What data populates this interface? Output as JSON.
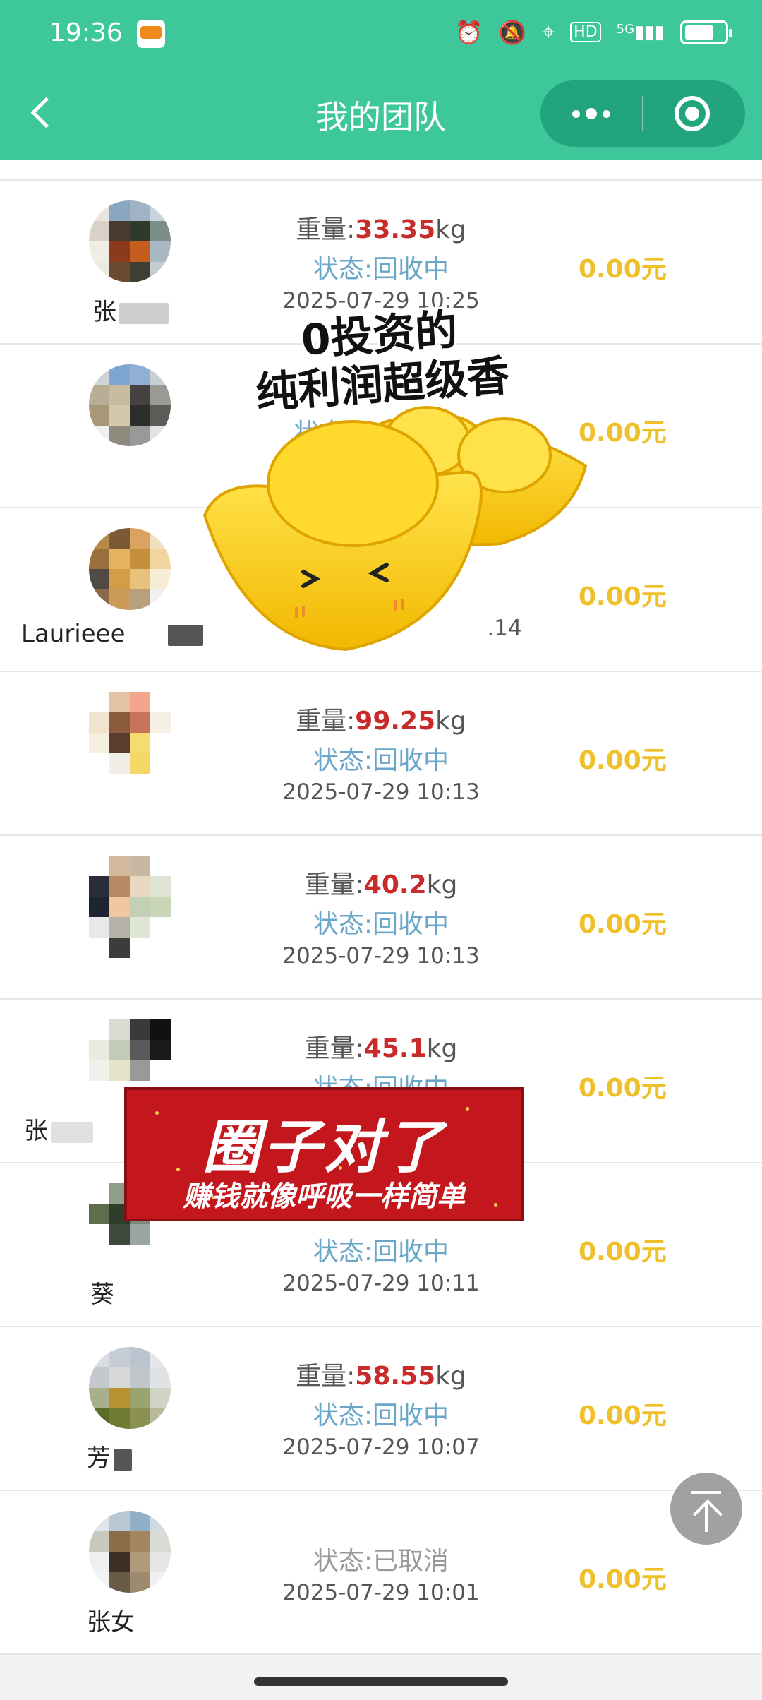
{
  "status_bar": {
    "time": "19:36",
    "network": "5G",
    "hd_label": "HD"
  },
  "nav": {
    "title": "我的团队"
  },
  "rows": [
    {
      "name": "张",
      "weight_prefix": "重量:",
      "weight": "33.35",
      "unit": "kg",
      "status": "状态:回收中",
      "date": "2025-07-29 10:25",
      "amount": "0.00元"
    },
    {
      "name": "",
      "weight_prefix": "",
      "weight": "",
      "unit": "",
      "status": "状态",
      "date": "2025",
      "amount": "0.00元"
    },
    {
      "name": "Laurieee",
      "weight_prefix": "",
      "weight": "",
      "unit": "",
      "status": "",
      "date": ".14",
      "amount": "0.00元"
    },
    {
      "name": "",
      "weight_prefix": "重量:",
      "weight": "99.25",
      "unit": "kg",
      "status": "状态:回收中",
      "date": "2025-07-29 10:13",
      "amount": "0.00元"
    },
    {
      "name": "",
      "weight_prefix": "重量:",
      "weight": "40.2",
      "unit": "kg",
      "status": "状态:回收中",
      "date": "2025-07-29 10:13",
      "amount": "0.00元"
    },
    {
      "name": "张",
      "weight_prefix": "重量:",
      "weight": "45.1",
      "unit": "kg",
      "status": "状态:回收中",
      "date": "",
      "amount": "0.00元"
    },
    {
      "name": "葵",
      "weight_prefix": "",
      "weight": "",
      "unit": "",
      "status": "状态:回收中",
      "date": "2025-07-29 10:11",
      "amount": "0.00元"
    },
    {
      "name": "芳",
      "weight_prefix": "重量:",
      "weight": "58.55",
      "unit": "kg",
      "status": "状态:回收中",
      "date": "2025-07-29 10:07",
      "amount": "0.00元"
    },
    {
      "name": "张女",
      "weight_prefix": "",
      "weight": "",
      "unit": "",
      "status": "状态:已取消",
      "date": "2025-07-29 10:01",
      "amount": "0.00元"
    }
  ],
  "sticker": {
    "line1": "0投资的",
    "line2": "纯利润超级香"
  },
  "banner": {
    "title": "圈子对了",
    "subtitle": "赚钱就像呼吸一样简单"
  },
  "colors": {
    "header": "#3ec79b",
    "weight_value": "#c92a2a",
    "status_active": "#6aa6c8",
    "amount": "#f0c02a"
  }
}
